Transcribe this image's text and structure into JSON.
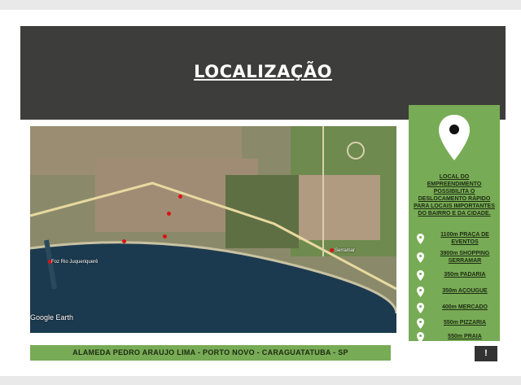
{
  "slide": {
    "title": "LOCALIZAÇÃO",
    "intro": "LOCAL DO EMPREENDIMENTO POSSIBILITA O DESLOCAMENTO RÁPIDO PARA LOCAIS IMPORTANTES DO BAIRRO E DA CIDADE.",
    "points": [
      {
        "label": "1100m PRAÇA DE EVENTOS",
        "icon": "location-pin-icon"
      },
      {
        "label": "3900m SHOPPING SERRAMAR",
        "icon": "location-pin-icon"
      },
      {
        "label": "350m PADARIA",
        "icon": "location-pin-icon"
      },
      {
        "label": "350m AÇOUGUE",
        "icon": "location-pin-icon"
      },
      {
        "label": "400m MERCADO",
        "icon": "location-pin-icon"
      },
      {
        "label": "550m PIZZARIA",
        "icon": "location-pin-icon"
      },
      {
        "label": "550m PRAIA",
        "icon": "location-pin-icon"
      }
    ],
    "address": "ALAMEDA PEDRO ARAUJO LIMA - PORTO NOVO - CARAGUATATUBA - SP",
    "map": {
      "watermark": "Google Earth",
      "labels": [
        "Foz Rio Juqueriquerê",
        "Serramar"
      ]
    },
    "colors": {
      "accent": "#78ab55",
      "header": "#3d3d3b"
    }
  }
}
